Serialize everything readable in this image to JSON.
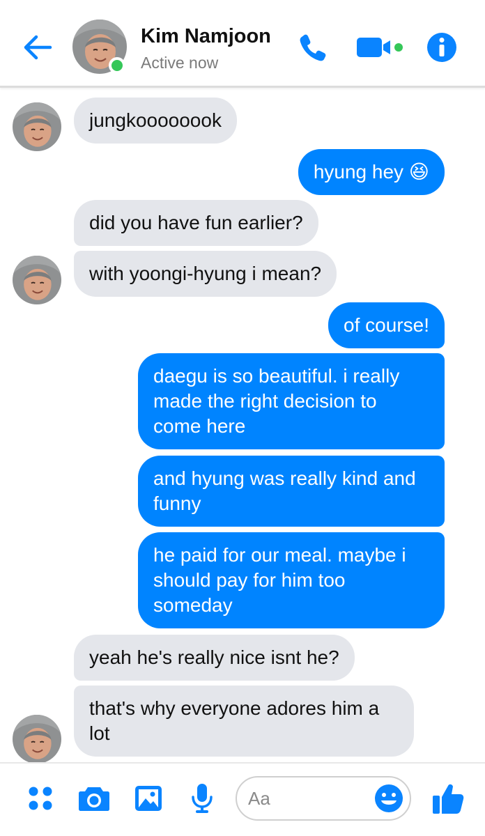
{
  "header": {
    "contact_name": "Kim Namjoon",
    "status": "Active now",
    "icons": [
      "back-arrow-icon",
      "phone-icon",
      "video-camera-icon",
      "info-icon"
    ]
  },
  "messages": [
    {
      "from": "them",
      "text": "jungkoooooook"
    },
    {
      "from": "me",
      "text": "hyung hey 😆"
    },
    {
      "from": "them",
      "text": "did you have fun earlier?"
    },
    {
      "from": "them",
      "text": "with yoongi-hyung i mean?"
    },
    {
      "from": "me",
      "text": "of course!"
    },
    {
      "from": "me",
      "text": "daegu is so beautiful. i really made the right decision to come here"
    },
    {
      "from": "me",
      "text": "and hyung was really kind and funny"
    },
    {
      "from": "me",
      "text": "he paid for our meal. maybe i should pay for him too someday"
    },
    {
      "from": "them",
      "text": "yeah he's really nice isnt he?"
    },
    {
      "from": "them",
      "text": "that's why everyone adores him a lot"
    }
  ],
  "composer": {
    "placeholder": "Aa",
    "icons": [
      "menu-dots-icon",
      "camera-icon",
      "image-icon",
      "microphone-icon",
      "emoji-icon",
      "thumbs-up-icon"
    ]
  },
  "colors": {
    "accent": "#0084ff",
    "incoming_bubble": "#e4e6eb",
    "online": "#35c759"
  }
}
